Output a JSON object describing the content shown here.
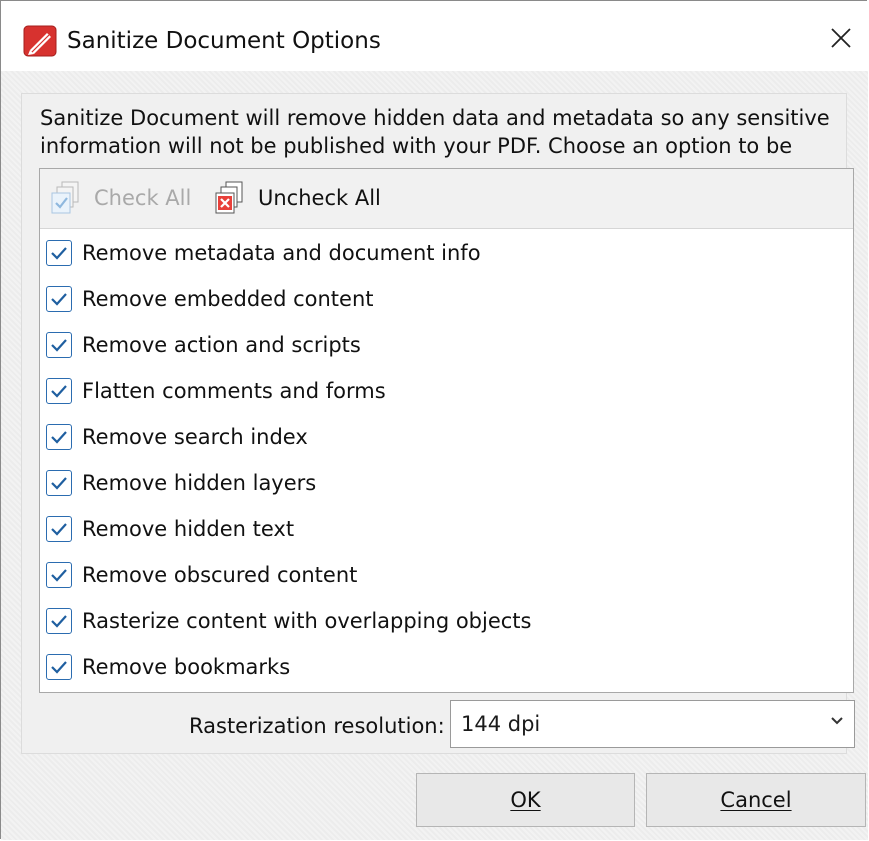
{
  "window": {
    "title": "Sanitize Document Options",
    "app_icon": "pdf-pen-icon",
    "close_icon": "close-icon"
  },
  "description": "Sanitize Document will remove hidden data and metadata so any sensitive information will not be published with your PDF. Choose an option to be",
  "toolbar": {
    "check_all_label": "Check All",
    "check_all_enabled": false,
    "uncheck_all_label": "Uncheck All",
    "uncheck_all_enabled": true
  },
  "options": [
    {
      "label": "Remove metadata and document info",
      "checked": true
    },
    {
      "label": "Remove embedded content",
      "checked": true
    },
    {
      "label": "Remove action and scripts",
      "checked": true
    },
    {
      "label": "Flatten comments and forms",
      "checked": true
    },
    {
      "label": "Remove search index",
      "checked": true
    },
    {
      "label": "Remove hidden layers",
      "checked": true
    },
    {
      "label": "Remove hidden text",
      "checked": true
    },
    {
      "label": "Remove obscured content",
      "checked": true
    },
    {
      "label": "Rasterize content with overlapping objects",
      "checked": true
    },
    {
      "label": "Remove bookmarks",
      "checked": true
    }
  ],
  "resolution": {
    "label": "Rasterization resolution:",
    "value": "144 dpi"
  },
  "buttons": {
    "ok_label": "OK",
    "cancel_label": "Cancel"
  },
  "colors": {
    "checkbox_border": "#2b6cb0",
    "checkmark": "#1f5fa0",
    "app_icon_red": "#d7322f"
  }
}
